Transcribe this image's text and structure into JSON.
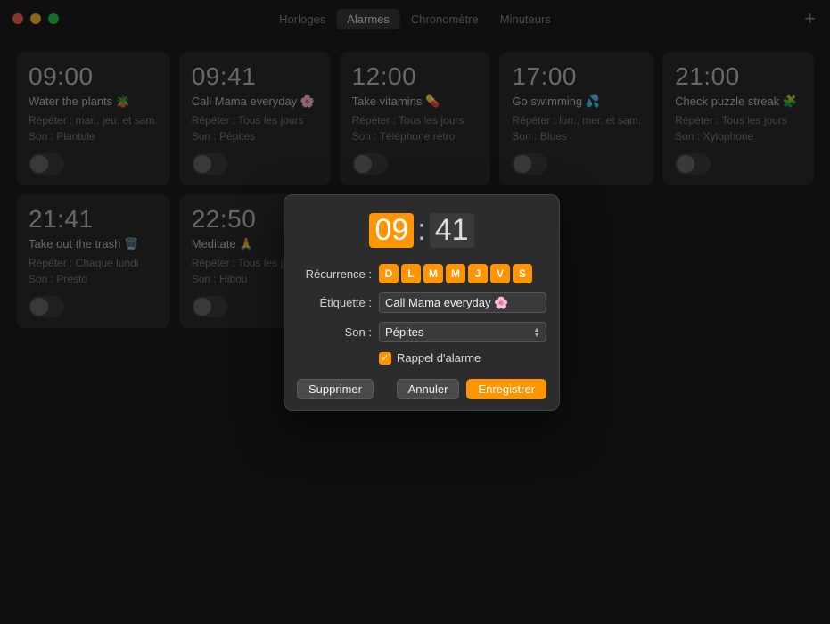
{
  "tabs": {
    "items": [
      "Horloges",
      "Alarmes",
      "Chronomètre",
      "Minuteurs"
    ],
    "active": 1
  },
  "alarms": [
    {
      "time": "09:00",
      "label": "Water the plants 🪴",
      "repeat": "Répéter : mar., jeu. et sam.",
      "sound": "Son : Plantule"
    },
    {
      "time": "09:41",
      "label": "Call Mama everyday 🌸",
      "repeat": "Répéter : Tous les jours",
      "sound": "Son : Pépites"
    },
    {
      "time": "12:00",
      "label": "Take vitamins 💊",
      "repeat": "Répéter : Tous les jours",
      "sound": "Son : Téléphone rétro"
    },
    {
      "time": "17:00",
      "label": "Go swimming 💦",
      "repeat": "Répéter : lun., mer. et sam.",
      "sound": "Son : Blues"
    },
    {
      "time": "21:00",
      "label": "Check puzzle streak 🧩",
      "repeat": "Répéter : Tous les jours",
      "sound": "Son : Xylophone"
    },
    {
      "time": "21:41",
      "label": "Take out the trash 🗑️",
      "repeat": "Répéter : Chaque lundi",
      "sound": "Son : Presto"
    },
    {
      "time": "22:50",
      "label": "Meditate 🙏",
      "repeat": "Répéter : Tous les jours",
      "sound": "Son : Hibou"
    }
  ],
  "dialog": {
    "hours": "09",
    "minutes": "41",
    "recurrence_label": "Récurrence :",
    "days": [
      "D",
      "L",
      "M",
      "M",
      "J",
      "V",
      "S"
    ],
    "etiquette_label": "Étiquette :",
    "etiquette_value": "Call Mama everyday 🌸",
    "son_label": "Son :",
    "son_value": "Pépites",
    "snooze_label": "Rappel d'alarme",
    "delete": "Supprimer",
    "cancel": "Annuler",
    "save": "Enregistrer"
  },
  "add_glyph": "+"
}
